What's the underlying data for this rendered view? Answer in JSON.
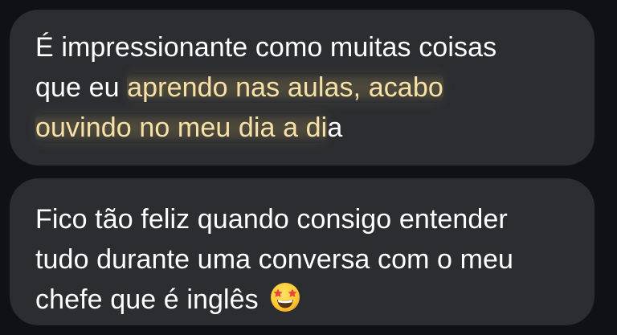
{
  "messages": [
    {
      "lines": {
        "l1": "É impressionante como muitas coisas",
        "l2_pre": "que eu ",
        "l2_hl": "aprendo nas aulas, acabo",
        "l3_hl": "ouvindo no meu dia a di",
        "l3_post": "a"
      }
    },
    {
      "lines": {
        "l1": "Fico tão feliz quando consigo entender",
        "l2": "tudo durante uma conversa com o meu",
        "l3": "chefe que é inglês"
      },
      "emoji": "star-struck-emoji-icon"
    }
  ],
  "colors": {
    "background": "#0f1114",
    "bubble": "#2b2d31",
    "text": "#ffffff",
    "highlight_text": "#f6e1a8"
  }
}
